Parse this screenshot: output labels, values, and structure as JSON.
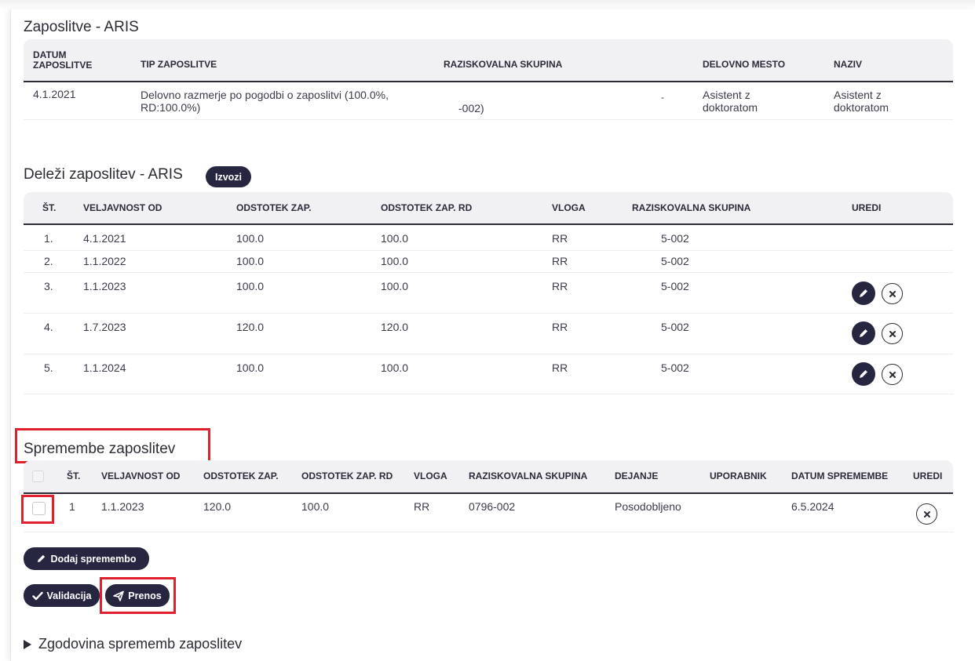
{
  "section1": {
    "title": "Zaposlitve - ARIS",
    "headers": {
      "datum_line1": "DATUM",
      "datum_line2": "ZAPOSLITVE",
      "tip": "TIP ZAPOSLITVE",
      "skupina": "RAZISKOVALNA SKUPINA",
      "mesto": "DELOVNO MESTO",
      "naziv": "NAZIV"
    },
    "row": {
      "datum": "4.1.2021",
      "tip_line1": "Delovno razmerje po pogodbi o zaposlitvi (100.0%,",
      "tip_line2": "RD:100.0%)",
      "skupina": "-002)",
      "dash": "-",
      "mesto_line1": "Asistent z",
      "mesto_line2": "doktoratom",
      "naziv_line1": "Asistent z",
      "naziv_line2": "doktoratom"
    }
  },
  "section2": {
    "title": "Deleži zaposlitev - ARIS",
    "export_label": "Izvozi",
    "headers": {
      "st": "ŠT.",
      "veljavnost": "VELJAVNOST OD",
      "odstotek": "ODSTOTEK ZAP.",
      "odstotek_rd": "ODSTOTEK ZAP. RD",
      "vloga": "VLOGA",
      "skupina": "RAZISKOVALNA SKUPINA",
      "uredi": "UREDI"
    },
    "rows": [
      {
        "st": "1.",
        "datum": "4.1.2021",
        "zap": "100.0",
        "rd": "100.0",
        "vloga": "RR",
        "skupina": "5-002"
      },
      {
        "st": "2.",
        "datum": "1.1.2022",
        "zap": "100.0",
        "rd": "100.0",
        "vloga": "RR",
        "skupina": "5-002"
      },
      {
        "st": "3.",
        "datum": "1.1.2023",
        "zap": "100.0",
        "rd": "100.0",
        "vloga": "RR",
        "skupina": "5-002"
      },
      {
        "st": "4.",
        "datum": "1.7.2023",
        "zap": "120.0",
        "rd": "120.0",
        "vloga": "RR",
        "skupina": "5-002"
      },
      {
        "st": "5.",
        "datum": "1.1.2024",
        "zap": "100.0",
        "rd": "100.0",
        "vloga": "RR",
        "skupina": "5-002"
      }
    ]
  },
  "section3": {
    "title": "Spremembe zaposlitev",
    "headers": {
      "st": "ŠT.",
      "veljavnost": "VELJAVNOST OD",
      "odstotek": "ODSTOTEK ZAP.",
      "odstotek_rd": "ODSTOTEK ZAP. RD",
      "vloga": "VLOGA",
      "skupina": "RAZISKOVALNA SKUPINA",
      "dejanje": "DEJANJE",
      "uporabnik": "UPORABNIK",
      "datum_spremembe": "DATUM SPREMEMBE",
      "uredi": "UREDI"
    },
    "row": {
      "st": "1",
      "datum": "1.1.2023",
      "zap": "120.0",
      "rd": "100.0",
      "vloga": "RR",
      "skupina": "0796-002",
      "dejanje": "Posodobljeno",
      "uporabnik": "",
      "datum_spremembe": "6.5.2024"
    }
  },
  "buttons": {
    "add_change": "Dodaj spremembo",
    "validate": "Validacija",
    "transfer": "Prenos"
  },
  "history": {
    "label": "Zgodovina sprememb zaposlitev"
  },
  "colors": {
    "pill_bg": "#262641",
    "highlight": "#e0202a",
    "header_bg": "#f1f1f4"
  }
}
